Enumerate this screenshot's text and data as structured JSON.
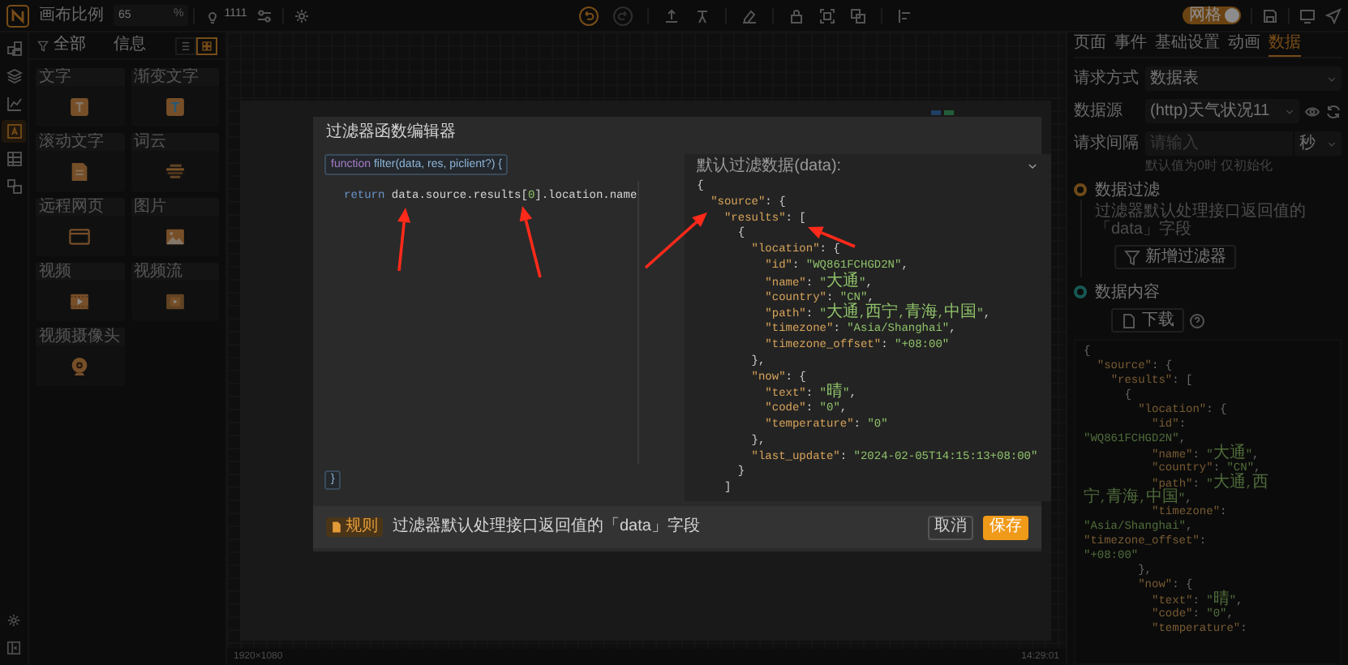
{
  "top_bar": {
    "scale_label": "画布比例",
    "scale_value": "65",
    "scale_unit": "%",
    "counter": "1111",
    "undo_enabled": true,
    "redo_enabled": false,
    "grid_toggle": {
      "label": "网格",
      "on": true
    }
  },
  "left_rail": {
    "items": [
      {
        "selected": false
      },
      {
        "selected": false
      },
      {
        "selected": false
      },
      {
        "selected": true
      },
      {
        "selected": false
      },
      {
        "selected": false
      }
    ]
  },
  "component_panel": {
    "filter_label": "全部",
    "category": "信息",
    "views": [
      {
        "selected": false
      },
      {
        "selected": true
      }
    ],
    "cards": [
      {
        "title": "文字",
        "kind": "text"
      },
      {
        "title": "渐变文字",
        "kind": "gradient_text"
      },
      {
        "title": "滚动文字",
        "kind": "scroll_text"
      },
      {
        "title": "词云",
        "kind": "word_cloud"
      },
      {
        "title": "远程网页",
        "kind": "webpage"
      },
      {
        "title": "图片",
        "kind": "image"
      },
      {
        "title": "视频",
        "kind": "video"
      },
      {
        "title": "视频流",
        "kind": "video_stream"
      },
      {
        "title": "视频摄像头",
        "kind": "camera"
      }
    ]
  },
  "modal": {
    "title": "过滤器函数编辑器",
    "signature": [
      {
        "text": "function",
        "kind": "keyword"
      },
      {
        "text": " filter(data, res, piclient?) {",
        "kind": "name"
      }
    ],
    "code_lines": [
      [
        {
          "text": "return",
          "kind": "keyword"
        },
        {
          "text": " data.source.results[",
          "kind": "plain"
        },
        {
          "text": "0",
          "kind": "number"
        },
        {
          "text": "].location.name",
          "kind": "plain"
        }
      ]
    ],
    "closing": "}",
    "preview_title": "默认过滤数据(data):",
    "preview_lines": [
      "{",
      "  \"source\": {",
      "    \"results\": [",
      "      {",
      "        \"location\": {",
      "          \"id\": \"WQ861FCHGD2N\",",
      "          \"name\": \"大通\",",
      "          \"country\": \"CN\",",
      "          \"path\": \"大通,西宁,青海,中国\",",
      "          \"timezone\": \"Asia/Shanghai\",",
      "          \"timezone_offset\": \"+08:00\"",
      "        },",
      "        \"now\": {",
      "          \"text\": \"晴\",",
      "          \"code\": \"0\",",
      "          \"temperature\": \"0\"",
      "        },",
      "        \"last_update\": \"2024-02-05T14:15:13+08:00\"",
      "      }",
      "    ]"
    ],
    "rule_tag": "规则",
    "rule_text": "过滤器默认处理接口返回值的「data」字段",
    "buttons": [
      {
        "label": "取消",
        "kind": "secondary"
      },
      {
        "label": "保存",
        "kind": "primary"
      }
    ]
  },
  "right_panel": {
    "tabs": [
      {
        "label": "页面",
        "selected": false
      },
      {
        "label": "事件",
        "selected": false
      },
      {
        "label": "基础设置",
        "selected": false
      },
      {
        "label": "动画",
        "selected": false
      },
      {
        "label": "数据",
        "selected": true
      }
    ],
    "fields": [
      {
        "label": "请求方式",
        "kind": "select",
        "value": "数据表"
      },
      {
        "label": "数据源",
        "kind": "source",
        "value": "(http)天气状况11"
      },
      {
        "label": "请求间隔",
        "kind": "interval",
        "placeholder": "请输入",
        "unit": "秒"
      }
    ],
    "hint": "默认值为0时 仅初始化",
    "steps": [
      {
        "title": "数据过滤",
        "color": "#6e4918",
        "description": "过滤器默认处理接口返回值的「data」字段",
        "button": "新增过滤器",
        "kind": "filter"
      },
      {
        "title": "数据内容",
        "color": "#175853",
        "button": "下载",
        "kind": "download"
      }
    ],
    "data_lines": [
      "{",
      "  \"source\": {",
      "    \"results\": [",
      "      {",
      "        \"location\": {",
      "          \"id\":",
      "\"WQ861FCHGD2N\",",
      "          \"name\": \"大通\",",
      "          \"country\": \"CN\",",
      "          \"path\": \"大通,西",
      "宁,青海,中国\",",
      "          \"timezone\":",
      "\"Asia/Shanghai\",",
      "\"timezone_offset\":",
      "\"+08:00\"",
      "        },",
      "        \"now\": {",
      "          \"text\": \"晴\",",
      "          \"code\": \"0\",",
      "          \"temperature\":"
    ]
  },
  "status_bar": {
    "resolution": "1920×1080",
    "time": "14:29:01"
  }
}
